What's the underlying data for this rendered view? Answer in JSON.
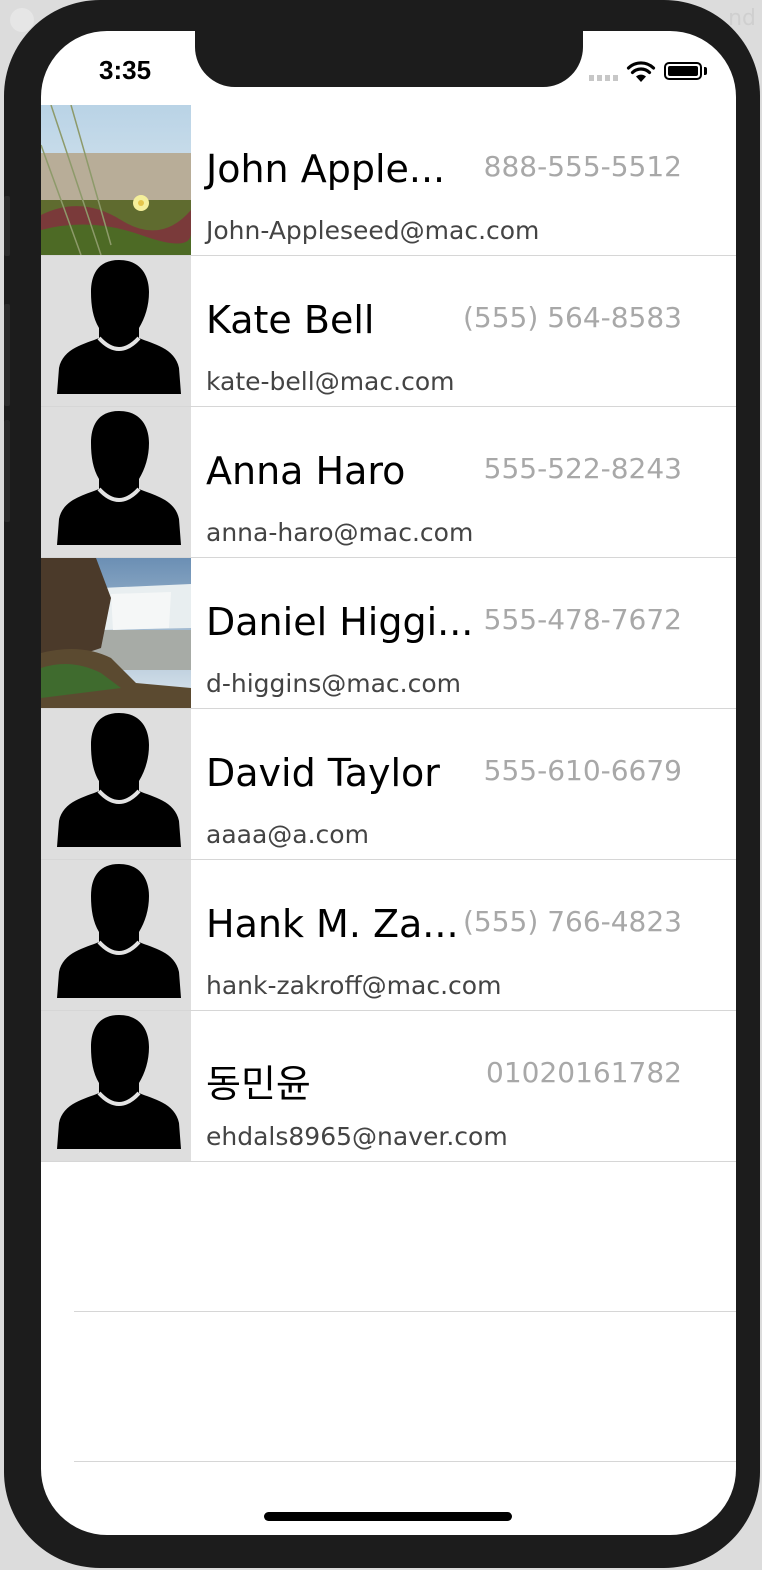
{
  "window": {
    "fragment_text": "nd"
  },
  "status_bar": {
    "time": "3:35",
    "icons": [
      "cellular-signal-icon",
      "wifi-icon",
      "battery-icon"
    ]
  },
  "contacts": [
    {
      "name": "John Apple...",
      "phone": "888-555-5512",
      "email": "John-Appleseed@mac.com",
      "photo": "landscape-flowers"
    },
    {
      "name": "Kate Bell",
      "phone": "(555) 564-8583",
      "email": "kate-bell@mac.com",
      "photo": "placeholder-person"
    },
    {
      "name": "Anna Haro",
      "phone": "555-522-8243",
      "email": "anna-haro@mac.com",
      "photo": "placeholder-person"
    },
    {
      "name": "Daniel Higgi...",
      "phone": "555-478-7672",
      "email": "d-higgins@mac.com",
      "photo": "landscape-waterfall"
    },
    {
      "name": "David Taylor",
      "phone": "555-610-6679",
      "email": "aaaa@a.com",
      "photo": "placeholder-person"
    },
    {
      "name": "Hank M. Za...",
      "phone": "(555) 766-4823",
      "email": "hank-zakroff@mac.com",
      "photo": "placeholder-person"
    },
    {
      "name": "동민윤",
      "phone": "01020161782",
      "email": "ehdals8965@naver.com",
      "photo": "placeholder-person"
    }
  ],
  "colors": {
    "phone_frame": "#1c1c1c",
    "separator": "#d6d6d6",
    "phone_text": "#a8a8a8",
    "email_text": "#444444",
    "placeholder_bg": "#dedede"
  }
}
